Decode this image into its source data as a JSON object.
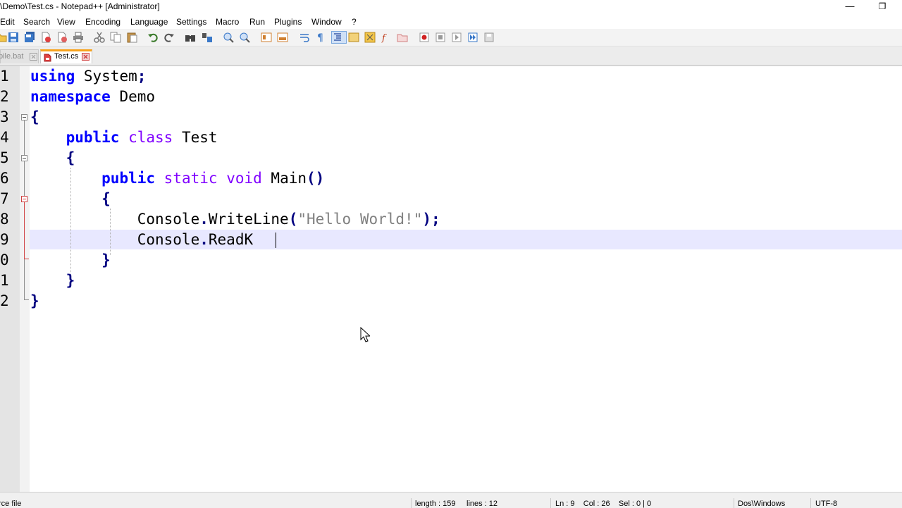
{
  "window": {
    "title": "\\Demo\\Test.cs - Notepad++ [Administrator]",
    "minimize_glyph": "—",
    "restore_glyph": "❐"
  },
  "menu": [
    "Edit",
    "Search",
    "View",
    "Encoding",
    "Language",
    "Settings",
    "Macro",
    "Run",
    "Plugins",
    "Window",
    "?"
  ],
  "tabs": [
    {
      "label": "pile.bat",
      "active": false
    },
    {
      "label": "Test.cs",
      "active": true
    }
  ],
  "editor": {
    "line_numbers": [
      "1",
      "2",
      "3",
      "4",
      "5",
      "6",
      "7",
      "8",
      "9",
      "0",
      "1",
      "2"
    ],
    "tokens": {
      "l1": [
        "using",
        "System",
        ";"
      ],
      "l2": [
        "namespace",
        "Demo"
      ],
      "l3": [
        "{"
      ],
      "l4": [
        "public",
        "class",
        "Test"
      ],
      "l5": [
        "{"
      ],
      "l6": [
        "public",
        "static",
        "void",
        "Main",
        "()"
      ],
      "l7": [
        "{"
      ],
      "l8": [
        "Console",
        ".",
        "WriteLine",
        "(",
        "\"Hello World!\"",
        ");"
      ],
      "l9": [
        "Console",
        ".",
        "ReadK"
      ],
      "l10": [
        "}"
      ],
      "l11": [
        "}"
      ],
      "l12": [
        "}"
      ]
    }
  },
  "status": {
    "file_type": "rce file",
    "length": "length : 159",
    "lines": "lines : 12",
    "position": "Ln : 9    Col : 26    Sel : 0 | 0",
    "eol": "Dos\\Windows",
    "encoding": "UTF-8"
  },
  "colors": {
    "keyword": "#0000ff",
    "type_keyword": "#8000ff",
    "string": "#808080",
    "current_line": "#e8e8ff",
    "active_tab_accent": "#f7a21c"
  }
}
